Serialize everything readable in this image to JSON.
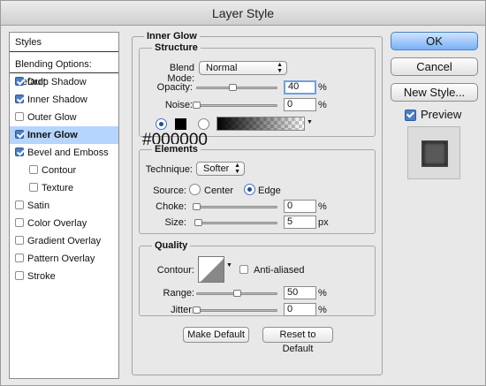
{
  "window": {
    "title": "Layer Style"
  },
  "styles_panel": {
    "header": "Styles",
    "blending": "Blending Options: Default",
    "items": [
      {
        "label": "Drop Shadow",
        "checked": true
      },
      {
        "label": "Inner Shadow",
        "checked": true
      },
      {
        "label": "Outer Glow",
        "checked": false
      },
      {
        "label": "Inner Glow",
        "checked": true
      },
      {
        "label": "Bevel and Emboss",
        "checked": true
      },
      {
        "label": "Contour",
        "checked": false
      },
      {
        "label": "Texture",
        "checked": false
      },
      {
        "label": "Satin",
        "checked": false
      },
      {
        "label": "Color Overlay",
        "checked": false
      },
      {
        "label": "Gradient Overlay",
        "checked": false
      },
      {
        "label": "Pattern Overlay",
        "checked": false
      },
      {
        "label": "Stroke",
        "checked": false
      }
    ]
  },
  "inner_glow": {
    "title": "Inner Glow",
    "structure": {
      "title": "Structure",
      "blend_mode_label": "Blend Mode:",
      "blend_mode_value": "Normal",
      "opacity_label": "Opacity:",
      "opacity_value": "40",
      "opacity_unit": "%",
      "noise_label": "Noise:",
      "noise_value": "0",
      "noise_unit": "%",
      "color_hex": "#000000"
    },
    "elements": {
      "title": "Elements",
      "technique_label": "Technique:",
      "technique_value": "Softer",
      "source_label": "Source:",
      "source_center": "Center",
      "source_edge": "Edge",
      "choke_label": "Choke:",
      "choke_value": "0",
      "choke_unit": "%",
      "size_label": "Size:",
      "size_value": "5",
      "size_unit": "px"
    },
    "quality": {
      "title": "Quality",
      "contour_label": "Contour:",
      "anti_aliased": "Anti-aliased",
      "range_label": "Range:",
      "range_value": "50",
      "range_unit": "%",
      "jitter_label": "Jitter:",
      "jitter_value": "0",
      "jitter_unit": "%"
    },
    "make_default": "Make Default",
    "reset_default": "Reset to Default"
  },
  "actions": {
    "ok": "OK",
    "cancel": "Cancel",
    "new_style": "New Style...",
    "preview": "Preview"
  },
  "colors": {
    "selection": "#b5d5ff",
    "primary_button": "#79b0f4",
    "glow_color": "#000000"
  }
}
